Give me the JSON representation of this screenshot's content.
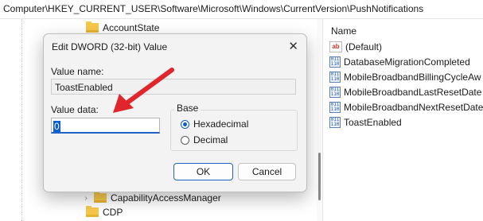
{
  "address_bar": {
    "path": "Computer\\HKEY_CURRENT_USER\\Software\\Microsoft\\Windows\\CurrentVersion\\PushNotifications"
  },
  "tree": {
    "items": [
      {
        "label": "AccountState",
        "icon": "folder-icon"
      },
      {
        "label": "CapabilityAccessManager",
        "icon": "folder-icon"
      },
      {
        "label": "CDP",
        "icon": "folder-icon"
      }
    ]
  },
  "values_pane": {
    "header": "Name",
    "items": [
      {
        "label": "(Default)",
        "icon": "string-value-icon"
      },
      {
        "label": "DatabaseMigrationCompleted",
        "icon": "binary-value-icon"
      },
      {
        "label": "MobileBroadbandBillingCycleAw",
        "icon": "binary-value-icon"
      },
      {
        "label": "MobileBroadbandLastResetDate",
        "icon": "binary-value-icon"
      },
      {
        "label": "MobileBroadbandNextResetDate",
        "icon": "binary-value-icon"
      },
      {
        "label": "ToastEnabled",
        "icon": "binary-value-icon"
      }
    ]
  },
  "dialog": {
    "title": "Edit DWORD (32-bit) Value",
    "close_glyph": "✕",
    "value_name_label": "Value name:",
    "value_name": "ToastEnabled",
    "value_data_label": "Value data:",
    "value_data": "0",
    "base_label": "Base",
    "radio_hex": "Hexadecimal",
    "radio_dec": "Decimal",
    "selected_base": "Hexadecimal",
    "ok_label": "OK",
    "cancel_label": "Cancel"
  },
  "colors": {
    "accent": "#1f63c6",
    "arrow": "#e0262a",
    "folder": "#f6c94a"
  }
}
